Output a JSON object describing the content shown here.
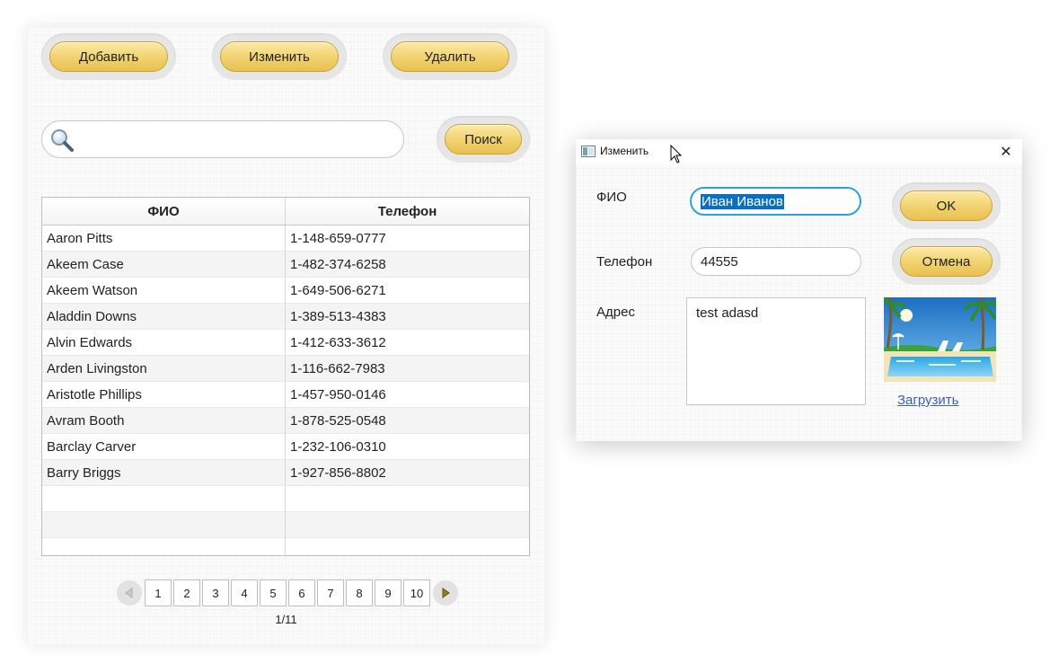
{
  "main": {
    "toolbar": {
      "add_label": "Добавить",
      "edit_label": "Изменить",
      "delete_label": "Удалить"
    },
    "search": {
      "value": "",
      "button_label": "Поиск"
    },
    "table": {
      "columns": [
        "ФИО",
        "Телефон"
      ],
      "rows": [
        [
          "Aaron Pitts",
          "1-148-659-0777"
        ],
        [
          "Akeem Case",
          "1-482-374-6258"
        ],
        [
          "Akeem Watson",
          "1-649-506-6271"
        ],
        [
          "Aladdin Downs",
          "1-389-513-4383"
        ],
        [
          "Alvin Edwards",
          "1-412-633-3612"
        ],
        [
          "Arden Livingston",
          "1-116-662-7983"
        ],
        [
          "Aristotle Phillips",
          "1-457-950-0146"
        ],
        [
          "Avram Booth",
          "1-878-525-0548"
        ],
        [
          "Barclay Carver",
          "1-232-106-0310"
        ],
        [
          "Barry Briggs",
          "1-927-856-8802"
        ],
        [
          "",
          ""
        ],
        [
          "",
          ""
        ],
        [
          "",
          ""
        ]
      ]
    },
    "pagination": {
      "pages": [
        "1",
        "2",
        "3",
        "4",
        "5",
        "6",
        "7",
        "8",
        "9",
        "10"
      ],
      "page_label": "1/11"
    }
  },
  "dialog": {
    "title": "Изменить",
    "close_glyph": "✕",
    "fio_label": "ФИО",
    "fio_value": "Иван Иванов",
    "phone_label": "Телефон",
    "phone_value": "44555",
    "address_label": "Адрес",
    "address_value": "test adasd",
    "ok_label": "OK",
    "cancel_label": "Отмена",
    "upload_label": "Загрузить"
  },
  "colors": {
    "button_gold": "#f3d676",
    "focus_border": "#2aa3dd",
    "selection": "#0a6fc2",
    "link": "#3b5fc0"
  }
}
